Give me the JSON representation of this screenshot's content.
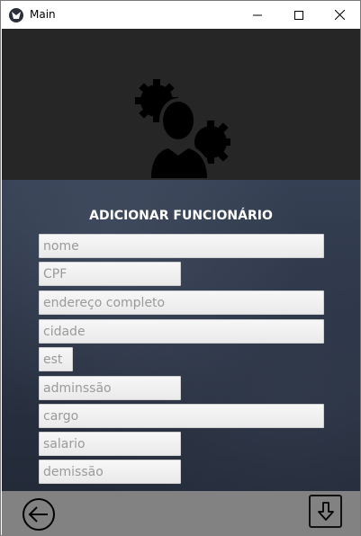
{
  "window": {
    "title": "Main",
    "app_icon": "kivy-icon",
    "controls": [
      "minimize-icon",
      "maximize-icon",
      "close-icon"
    ]
  },
  "header": {
    "icon": "user-gear-icon",
    "background": "#262626"
  },
  "form": {
    "title": "ADICIONAR FUNCIONÁRIO",
    "fields": {
      "nome": {
        "placeholder": "nome",
        "value": ""
      },
      "cpf": {
        "placeholder": "CPF",
        "value": ""
      },
      "endereco": {
        "placeholder": "endereço completo",
        "value": ""
      },
      "cidade": {
        "placeholder": "cidade",
        "value": ""
      },
      "est": {
        "placeholder": "est",
        "value": ""
      },
      "admissao": {
        "placeholder": "adminssão",
        "value": ""
      },
      "cargo": {
        "placeholder": "cargo",
        "value": ""
      },
      "salario": {
        "placeholder": "salario",
        "value": ""
      },
      "demissao": {
        "placeholder": "demissão",
        "value": ""
      }
    }
  },
  "footer": {
    "back_icon": "back-arrow-icon",
    "save_icon": "download-icon",
    "background": "#828282"
  }
}
